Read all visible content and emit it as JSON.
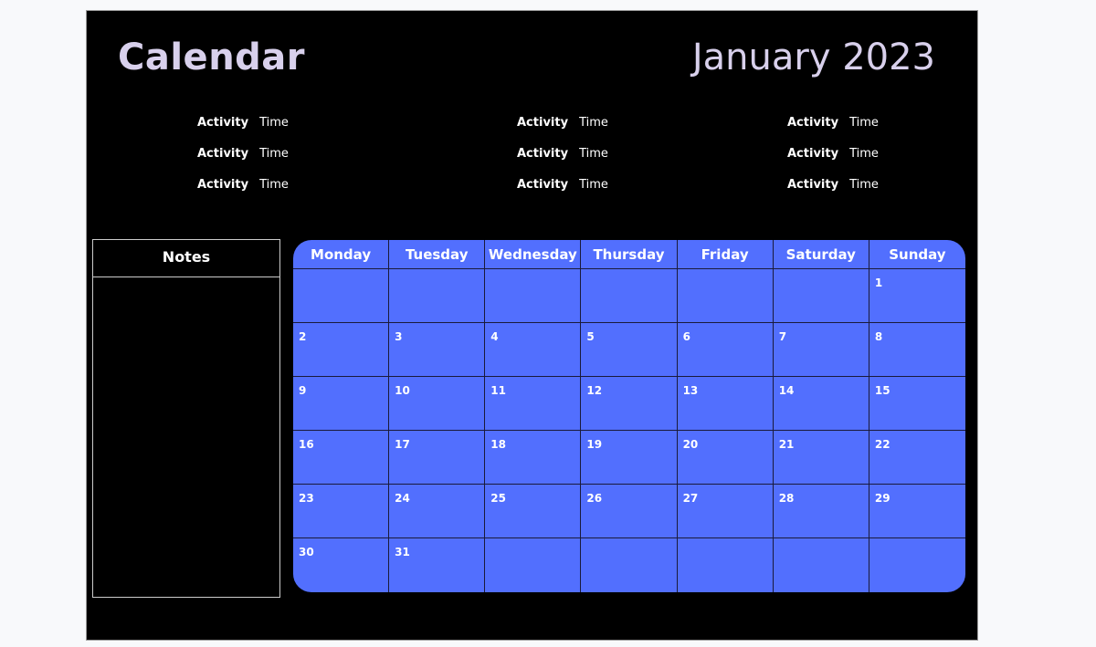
{
  "header": {
    "title": "Calendar",
    "month": "January 2023"
  },
  "activities": [
    [
      {
        "activity": "Activity",
        "time": "Time"
      },
      {
        "activity": "Activity",
        "time": "Time"
      },
      {
        "activity": "Activity",
        "time": "Time"
      }
    ],
    [
      {
        "activity": "Activity",
        "time": "Time"
      },
      {
        "activity": "Activity",
        "time": "Time"
      },
      {
        "activity": "Activity",
        "time": "Time"
      }
    ],
    [
      {
        "activity": "Activity",
        "time": "Time"
      },
      {
        "activity": "Activity",
        "time": "Time"
      },
      {
        "activity": "Activity",
        "time": "Time"
      }
    ]
  ],
  "notes": {
    "title": "Notes"
  },
  "calendar": {
    "weekdays": [
      "Monday",
      "Tuesday",
      "Wednesday",
      "Thursday",
      "Friday",
      "Saturday",
      "Sunday"
    ],
    "days": [
      "",
      "",
      "",
      "",
      "",
      "",
      "1",
      "2",
      "3",
      "4",
      "5",
      "6",
      "7",
      "8",
      "9",
      "10",
      "11",
      "12",
      "13",
      "14",
      "15",
      "16",
      "17",
      "18",
      "19",
      "20",
      "21",
      "22",
      "23",
      "24",
      "25",
      "26",
      "27",
      "28",
      "29",
      "30",
      "31",
      "",
      "",
      "",
      "",
      ""
    ],
    "colors": {
      "grid": "#526ffe",
      "background": "#000000",
      "title": "#d8d0ec"
    }
  }
}
